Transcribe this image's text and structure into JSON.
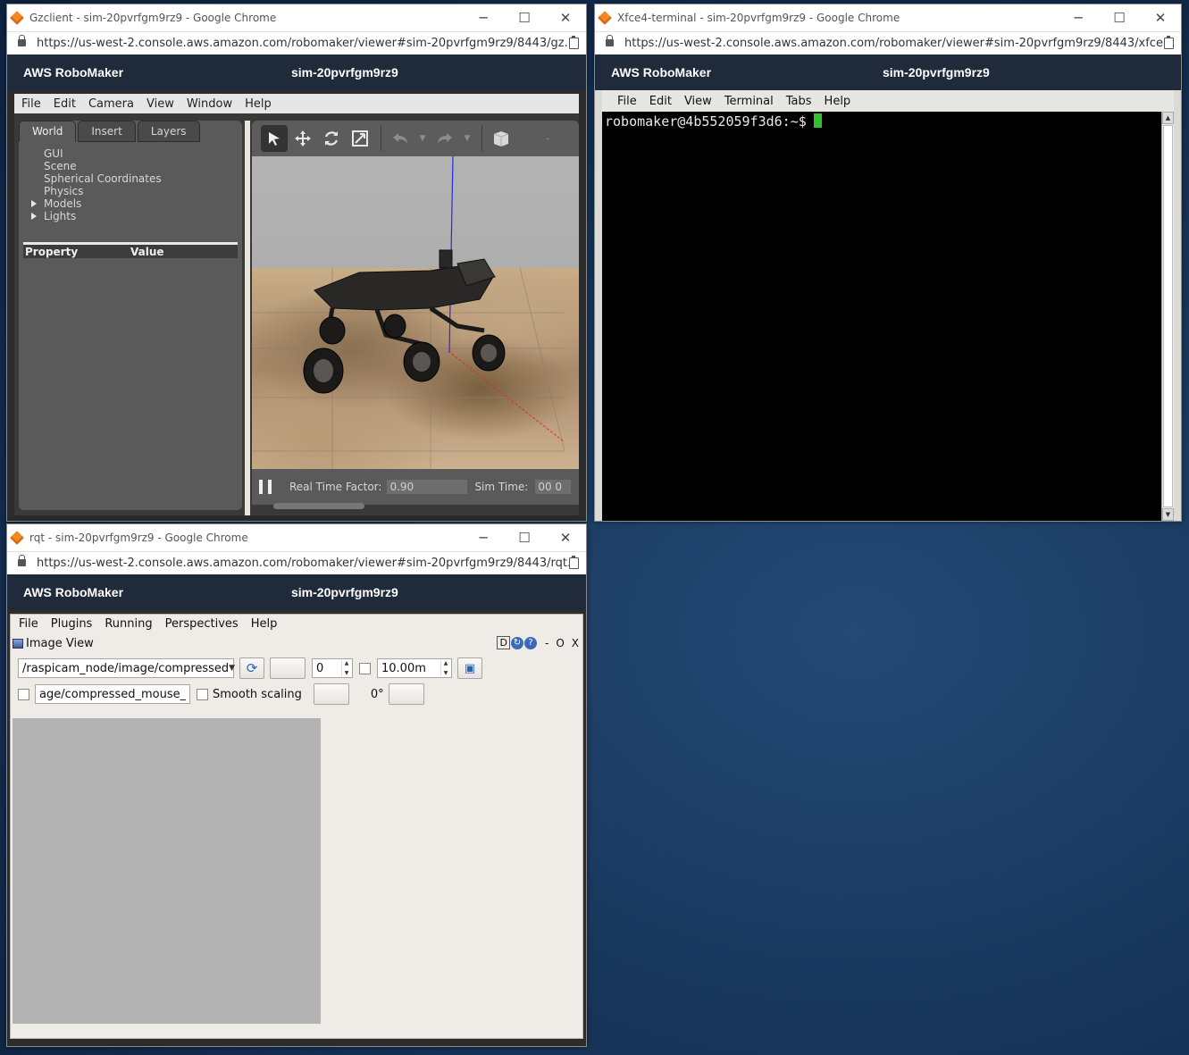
{
  "gazebo_window": {
    "title": "Gzclient - sim-20pvrfgm9rz9 - Google Chrome",
    "url": "https://us-west-2.console.aws.amazon.com/robomaker/viewer#sim-20pvrfgm9rz9/8443/gz...",
    "header_brand": "AWS RoboMaker",
    "header_sim": "sim-20pvrfgm9rz9",
    "menu": [
      "File",
      "Edit",
      "Camera",
      "View",
      "Window",
      "Help"
    ],
    "tabs": [
      "World",
      "Insert",
      "Layers"
    ],
    "tree": [
      "GUI",
      "Scene",
      "Spherical Coordinates",
      "Physics",
      "Models",
      "Lights"
    ],
    "prop_col_property": "Property",
    "prop_col_value": "Value",
    "rtf_label": "Real Time Factor:",
    "rtf_value": "0.90",
    "simtime_label": "Sim Time:",
    "simtime_value": "00 0"
  },
  "terminal_window": {
    "title": "Xfce4-terminal - sim-20pvrfgm9rz9 - Google Chrome",
    "url": "https://us-west-2.console.aws.amazon.com/robomaker/viewer#sim-20pvrfgm9rz9/8443/xfce...",
    "header_brand": "AWS RoboMaker",
    "header_sim": "sim-20pvrfgm9rz9",
    "menu": [
      "File",
      "Edit",
      "View",
      "Terminal",
      "Tabs",
      "Help"
    ],
    "prompt": "robomaker@4b552059f3d6:~$"
  },
  "rqt_window": {
    "title": "rqt - sim-20pvrfgm9rz9 - Google Chrome",
    "url": "https://us-west-2.console.aws.amazon.com/robomaker/viewer#sim-20pvrfgm9rz9/8443/rqt...",
    "header_brand": "AWS RoboMaker",
    "header_sim": "sim-20pvrfgm9rz9",
    "menu": [
      "File",
      "Plugins",
      "Running",
      "Perspectives",
      "Help"
    ],
    "plugin_title": "Image View",
    "plugin_btn_d": "D",
    "plugin_btn_min": "-",
    "plugin_btn_o": "O",
    "plugin_btn_close": "X",
    "topic": "/raspicam_node/image/compressed",
    "spin_value": "0",
    "max_range": "10.00m",
    "mouse_topic": "age/compressed_mouse_left",
    "smooth_label": "Smooth scaling",
    "rotation": "0°"
  },
  "window_controls": {
    "minimize": "─",
    "maximize": "☐",
    "close": "✕"
  }
}
